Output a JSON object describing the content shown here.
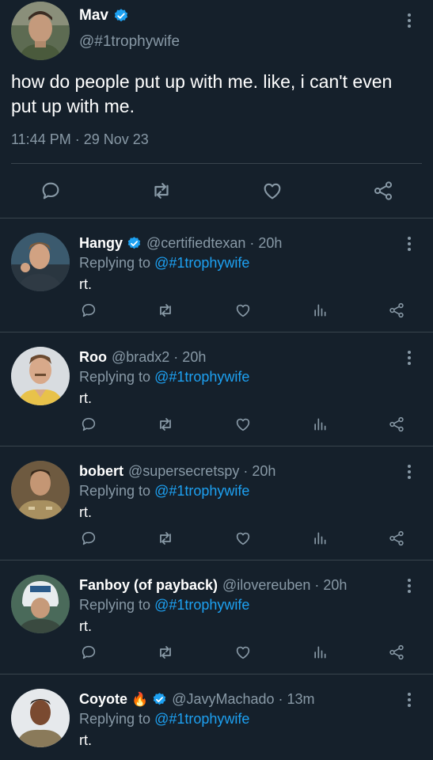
{
  "main_tweet": {
    "name": "Mav",
    "handle": "@#1trophywife",
    "text": "how do people put up with me. like, i can't even put up with me.",
    "timestamp": "11:44 PM · 29 Nov 23",
    "actions": [
      "reply-icon",
      "retweet-icon",
      "like-icon",
      "share-icon"
    ]
  },
  "replies": [
    {
      "name": "Hangy",
      "verified": true,
      "handle": "@certifiedtexan · 20h",
      "replying_prefix": "Replying to",
      "replying_to": "@#1trophywife",
      "text": "rt."
    },
    {
      "name": "Roo",
      "verified": false,
      "handle": "@bradx2 · 20h",
      "replying_prefix": "Replying to",
      "replying_to": "@#1trophywife",
      "text": "rt."
    },
    {
      "name": "bobert",
      "verified": false,
      "handle": "@supersecretspy · 20h",
      "replying_prefix": "Replying to",
      "replying_to": "@#1trophywife",
      "text": "rt."
    },
    {
      "name": "Fanboy (of payback)",
      "verified": false,
      "handle": "@ilovereuben · 20h",
      "replying_prefix": "Replying to",
      "replying_to": "@#1trophywife",
      "text": "rt."
    },
    {
      "name": "Coyote",
      "emoji": "🔥",
      "verified": true,
      "handle": "@JavyMachado · 13m",
      "replying_prefix": "Replying to",
      "replying_to": "@#1trophywife",
      "text": "rt."
    }
  ],
  "reply_actions": [
    "reply-icon",
    "retweet-icon",
    "like-icon",
    "analytics-icon",
    "share-icon"
  ],
  "colors": {
    "background": "#15202b",
    "secondary_text": "#8899a6",
    "link": "#1da1f2",
    "verified": "#1da1f2",
    "divider": "#38444d"
  }
}
